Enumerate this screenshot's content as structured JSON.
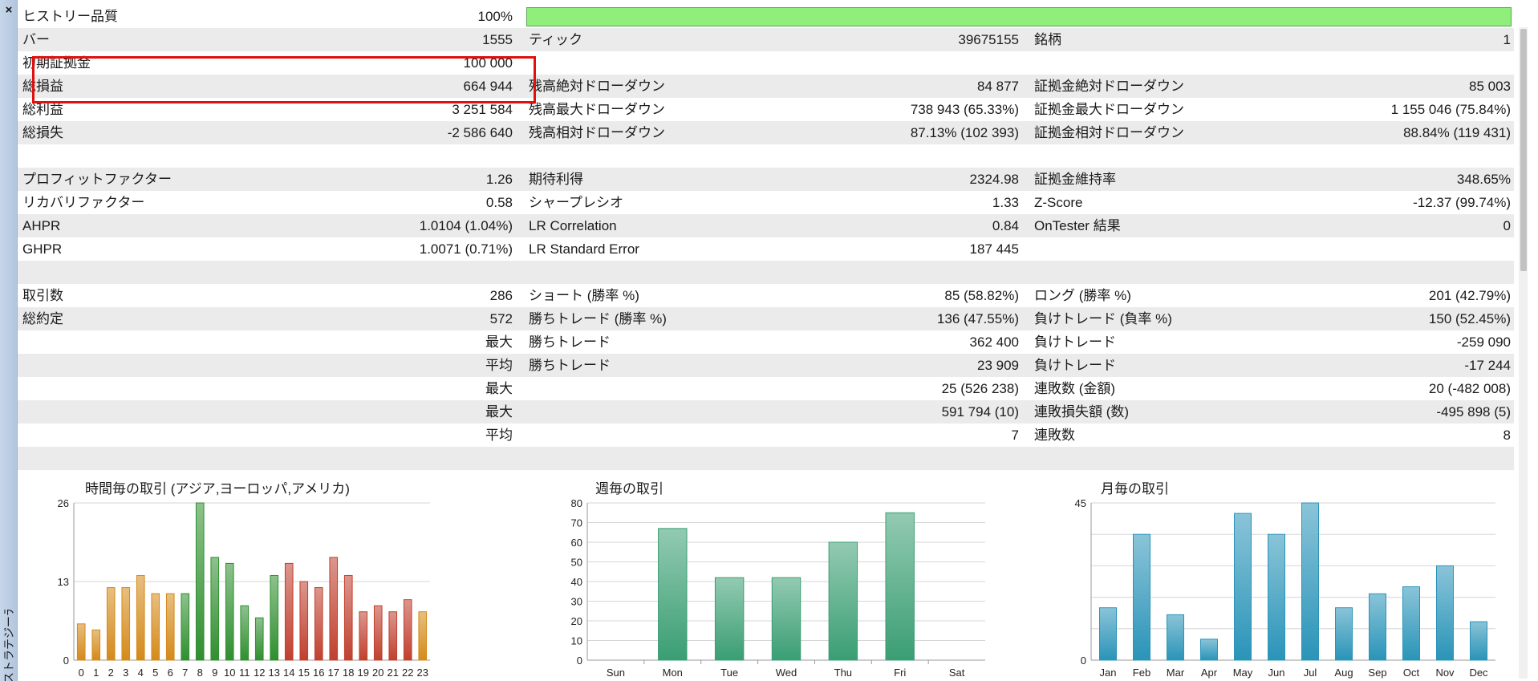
{
  "side_label": "ストラテジーテスター",
  "close_glyph": "×",
  "rows": [
    {
      "alt": false,
      "l1": "ヒストリー品質",
      "v1": "100%",
      "l2": "",
      "v2": "",
      "l3": "",
      "v3": "",
      "bar": true
    },
    {
      "alt": true,
      "l1": "バー",
      "v1": "1555",
      "l2": "ティック",
      "v2": "39675155",
      "l3": "銘柄",
      "v3": "1"
    },
    {
      "alt": false,
      "l1": "初期証拠金",
      "v1": "100 000",
      "l2": "",
      "v2": "",
      "l3": "",
      "v3": ""
    },
    {
      "alt": true,
      "l1": "総損益",
      "v1": "664 944",
      "l2": "残高絶対ドローダウン",
      "v2": "84 877",
      "l3": "証拠金絶対ドローダウン",
      "v3": "85 003"
    },
    {
      "alt": false,
      "l1": "総利益",
      "v1": "3 251 584",
      "l2": "残高最大ドローダウン",
      "v2": "738 943 (65.33%)",
      "l3": "証拠金最大ドローダウン",
      "v3": "1 155 046 (75.84%)"
    },
    {
      "alt": true,
      "l1": "総損失",
      "v1": "-2 586 640",
      "l2": "残高相対ドローダウン",
      "v2": "87.13% (102 393)",
      "l3": "証拠金相対ドローダウン",
      "v3": "88.84% (119 431)"
    },
    {
      "alt": false,
      "l1": "",
      "v1": "",
      "l2": "",
      "v2": "",
      "l3": "",
      "v3": ""
    },
    {
      "alt": true,
      "l1": "プロフィットファクター",
      "v1": "1.26",
      "l2": "期待利得",
      "v2": "2324.98",
      "l3": "証拠金維持率",
      "v3": "348.65%"
    },
    {
      "alt": false,
      "l1": "リカバリファクター",
      "v1": "0.58",
      "l2": "シャープレシオ",
      "v2": "1.33",
      "l3": "Z-Score",
      "v3": "-12.37 (99.74%)"
    },
    {
      "alt": true,
      "l1": "AHPR",
      "v1": "1.0104 (1.04%)",
      "l2": "LR Correlation",
      "v2": "0.84",
      "l3": "OnTester 結果",
      "v3": "0"
    },
    {
      "alt": false,
      "l1": "GHPR",
      "v1": "1.0071 (0.71%)",
      "l2": "LR Standard Error",
      "v2": "187 445",
      "l3": "",
      "v3": ""
    },
    {
      "alt": true,
      "l1": "",
      "v1": "",
      "l2": "",
      "v2": "",
      "l3": "",
      "v3": ""
    },
    {
      "alt": false,
      "l1": "取引数",
      "v1": "286",
      "l2": "ショート (勝率 %)",
      "v2": "85 (58.82%)",
      "l3": "ロング (勝率 %)",
      "v3": "201 (42.79%)"
    },
    {
      "alt": true,
      "l1": "総約定",
      "v1": "572",
      "l2": "勝ちトレード (勝率 %)",
      "v2": "136 (47.55%)",
      "l3": "負けトレード (負率 %)",
      "v3": "150 (52.45%)"
    },
    {
      "alt": false,
      "l1": "",
      "v1": "最大",
      "l2": "勝ちトレード",
      "v2": "362 400",
      "l3": "負けトレード",
      "v3": "-259 090"
    },
    {
      "alt": true,
      "l1": "",
      "v1": "平均",
      "l2": "勝ちトレード",
      "v2": "23 909",
      "l3": "負けトレード",
      "v3": "-17 244"
    },
    {
      "alt": false,
      "l1": "",
      "v1": "最大",
      "l2": "",
      "v2": "25 (526 238)",
      "l3": "連敗数 (金額)",
      "v3": "20 (-482 008)"
    },
    {
      "alt": true,
      "l1": "",
      "v1": "最大",
      "l2": "",
      "v2": "591 794 (10)",
      "l3": "連敗損失額 (数)",
      "v3": "-495 898 (5)"
    },
    {
      "alt": false,
      "l1": "",
      "v1": "平均",
      "l2": "",
      "v2": "7",
      "l3": "連敗数",
      "v3": "8"
    },
    {
      "alt": true,
      "l1": "",
      "v1": "",
      "l2": "",
      "v2": "",
      "l3": "",
      "v3": ""
    }
  ],
  "colors": {
    "quality_bar": "#90ee7a",
    "highlight": "#e01010"
  },
  "chart_data": [
    {
      "type": "bar",
      "title": "時間毎の取引 (アジア,ヨーロッパ,アメリカ)",
      "categories": [
        "0",
        "1",
        "2",
        "3",
        "4",
        "5",
        "6",
        "7",
        "8",
        "9",
        "10",
        "11",
        "12",
        "13",
        "14",
        "15",
        "16",
        "17",
        "18",
        "19",
        "20",
        "21",
        "22",
        "23"
      ],
      "values": [
        6,
        5,
        12,
        12,
        14,
        11,
        11,
        11,
        26,
        17,
        16,
        9,
        7,
        14,
        16,
        13,
        12,
        17,
        14,
        8,
        9,
        8,
        10,
        8
      ],
      "ylim": [
        0,
        26
      ],
      "yticks": [
        0,
        13,
        26
      ],
      "colors": [
        "#d48a1a",
        "#d48a1a",
        "#d48a1a",
        "#d48a1a",
        "#d48a1a",
        "#d48a1a",
        "#d48a1a",
        "#2f8f2f",
        "#2f8f2f",
        "#2f8f2f",
        "#2f8f2f",
        "#2f8f2f",
        "#2f8f2f",
        "#2f8f2f",
        "#c0402f",
        "#c0402f",
        "#c0402f",
        "#c0402f",
        "#c0402f",
        "#c0402f",
        "#c0402f",
        "#c0402f",
        "#c0402f",
        "#d48a1a"
      ]
    },
    {
      "type": "bar",
      "title": "週毎の取引",
      "categories": [
        "Sun",
        "Mon",
        "Tue",
        "Wed",
        "Thu",
        "Fri",
        "Sat"
      ],
      "values": [
        0,
        67,
        42,
        42,
        60,
        75,
        0
      ],
      "ylim": [
        0,
        80
      ],
      "yticks": [
        0,
        10,
        20,
        30,
        40,
        50,
        60,
        70,
        80
      ],
      "color": "#3a9e73"
    },
    {
      "type": "bar",
      "title": "月毎の取引",
      "categories": [
        "Jan",
        "Feb",
        "Mar",
        "Apr",
        "May",
        "Jun",
        "Jul",
        "Aug",
        "Sep",
        "Oct",
        "Nov",
        "Dec"
      ],
      "values": [
        15,
        36,
        13,
        6,
        42,
        36,
        45,
        15,
        19,
        21,
        27,
        11
      ],
      "ylim": [
        0,
        45
      ],
      "yticks": [
        0,
        45
      ],
      "color": "#2a94b8"
    }
  ]
}
